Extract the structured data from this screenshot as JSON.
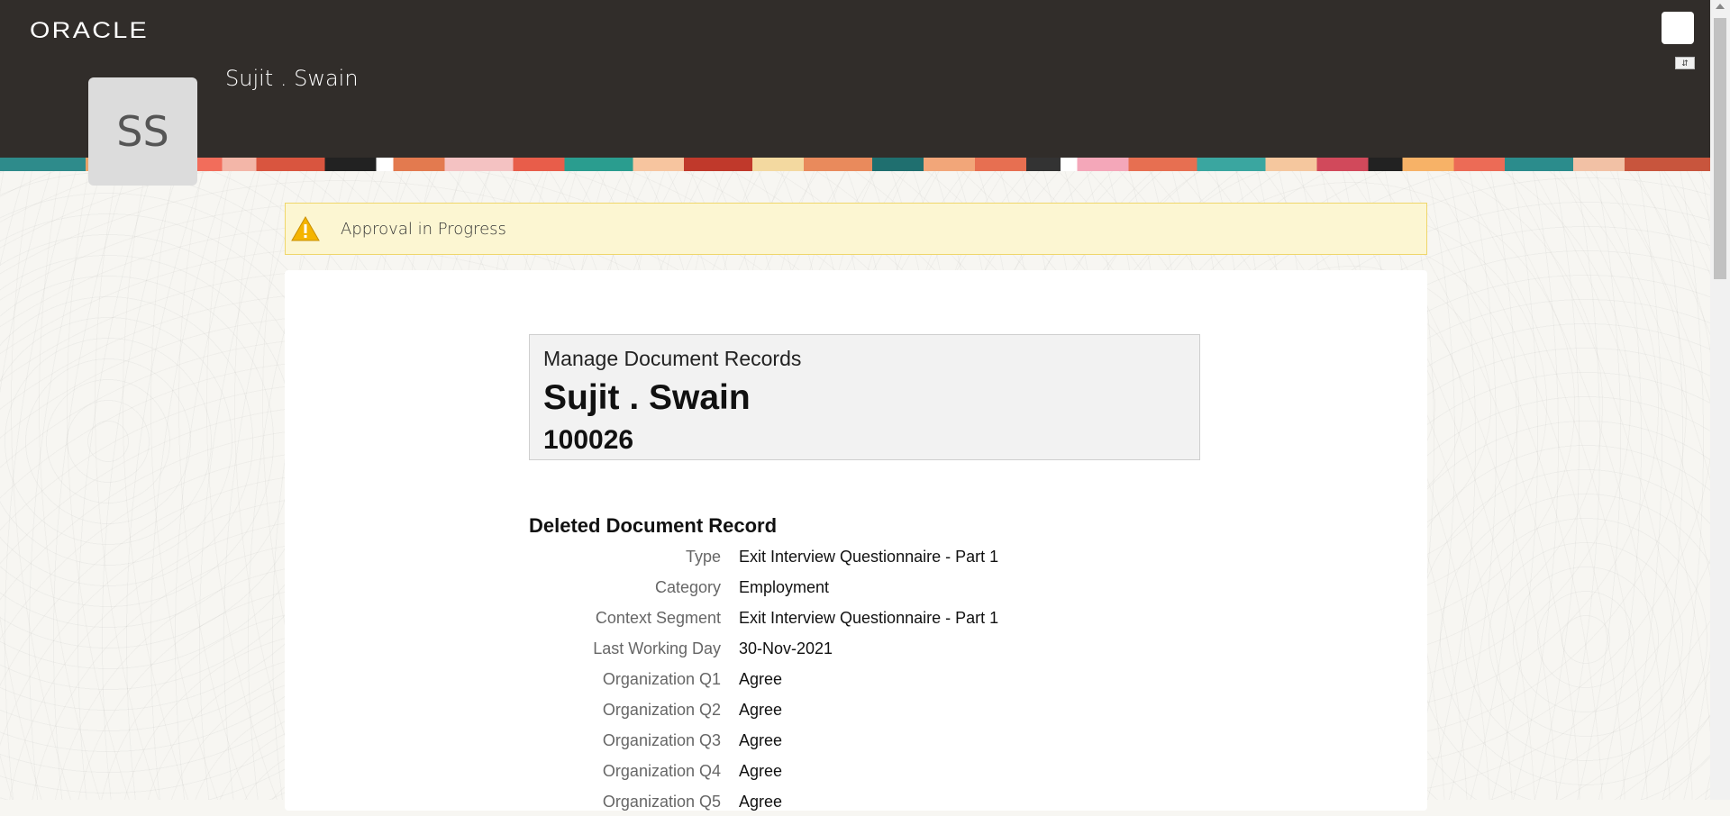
{
  "header": {
    "logo": "ORACLE",
    "user_name": "Sujit . Swain",
    "avatar_initials": "SS"
  },
  "alert": {
    "icon": "warning-icon",
    "message": "Approval in Progress"
  },
  "document": {
    "subtitle": "Manage Document Records",
    "person_name": "Sujit . Swain",
    "person_number": "100026"
  },
  "section": {
    "title": "Deleted Document Record",
    "rows": [
      {
        "label": "Type",
        "value": "Exit Interview Questionnaire - Part 1"
      },
      {
        "label": "Category",
        "value": "Employment"
      },
      {
        "label": "Context Segment",
        "value": "Exit Interview Questionnaire - Part 1"
      },
      {
        "label": "Last Working Day",
        "value": "30-Nov-2021"
      },
      {
        "label": "Organization Q1",
        "value": "Agree"
      },
      {
        "label": "Organization Q2",
        "value": "Agree"
      },
      {
        "label": "Organization Q3",
        "value": "Agree"
      },
      {
        "label": "Organization Q4",
        "value": "Agree"
      },
      {
        "label": "Organization Q5",
        "value": "Agree"
      }
    ]
  }
}
